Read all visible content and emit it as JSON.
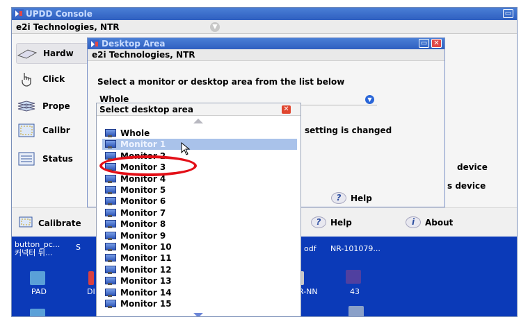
{
  "console": {
    "title": "UPDD Console",
    "device": "e2i Technologies, NTR",
    "nav": [
      {
        "label": "Hardw",
        "icon": "hardware-icon"
      },
      {
        "label": "Click",
        "icon": "hand-pointer-icon"
      },
      {
        "label": "Prope",
        "icon": "properties-icon"
      },
      {
        "label": "Calibr",
        "icon": "calibrate-icon"
      },
      {
        "label": "Status",
        "icon": "status-icon"
      }
    ],
    "right_texts": [
      "device",
      "s device"
    ],
    "bottom": {
      "calibrate": "Calibrate",
      "help": "Help",
      "about": "About"
    }
  },
  "desktop": {
    "labels": [
      "button_pc...",
      "커넥터 뒤...",
      "PAD",
      "DI",
      "odf",
      "NR-101079...",
      "R-NN",
      "43",
      "S"
    ]
  },
  "dialog": {
    "title": "Desktop Area",
    "device": "e2i Technologies, NTR",
    "instruction": "Select a monitor or desktop area from the list below",
    "selected": "Whole",
    "note": "setting is changed",
    "help": "Help"
  },
  "dropdown": {
    "header": "Select desktop area",
    "items": [
      "Whole",
      "Monitor 1",
      "Monitor 2",
      "Monitor 3",
      "Monitor 4",
      "Monitor 5",
      "Monitor 6",
      "Monitor 7",
      "Monitor 8",
      "Monitor 9",
      "Monitor 10",
      "Monitor 11",
      "Monitor 12",
      "Monitor 13",
      "Monitor 14",
      "Monitor 15"
    ],
    "highlighted": "Monitor 1",
    "circled": "Monitor 2"
  },
  "colors": {
    "titlebar": "#2f5fc0",
    "highlight": "#a9c2ea",
    "annotation": "#e30f17",
    "desktop": "#0b3ab8"
  }
}
